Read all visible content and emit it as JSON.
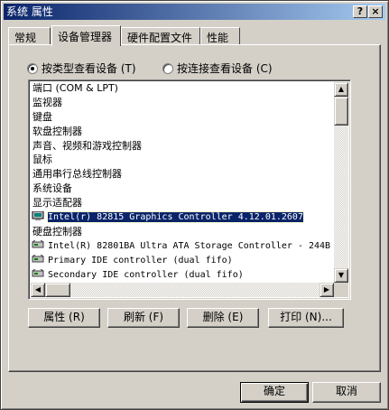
{
  "window": {
    "title": "系统 属性",
    "help_button": "?",
    "close_button": "×"
  },
  "tabs": [
    {
      "label": "常规"
    },
    {
      "label": "设备管理器"
    },
    {
      "label": "硬件配置文件"
    },
    {
      "label": "性能"
    }
  ],
  "view_options": {
    "by_type": "按类型查看设备 (T)",
    "by_connection": "按连接查看设备 (C)",
    "selected": "by_type"
  },
  "device_list": [
    {
      "text": "端口 (COM & LPT)",
      "icon": "",
      "child": false
    },
    {
      "text": "监视器",
      "icon": "",
      "child": false
    },
    {
      "text": "键盘",
      "icon": "",
      "child": false
    },
    {
      "text": "软盘控制器",
      "icon": "",
      "child": false
    },
    {
      "text": "声音、视频和游戏控制器",
      "icon": "",
      "child": false
    },
    {
      "text": "鼠标",
      "icon": "",
      "child": false
    },
    {
      "text": "通用串行总线控制器",
      "icon": "",
      "child": false
    },
    {
      "text": "系统设备",
      "icon": "",
      "child": false
    },
    {
      "text": "显示适配器",
      "icon": "",
      "child": false
    },
    {
      "text": "Intel(r) 82815 Graphics Controller 4.12.01.2607",
      "icon": "monitor-icon",
      "child": true,
      "selected": true
    },
    {
      "text": "硬盘控制器",
      "icon": "",
      "child": false
    },
    {
      "text": "Intel(R) 82801BA Ultra ATA Storage Controller - 244B",
      "icon": "disk-controller-icon",
      "child": true
    },
    {
      "text": "Primary IDE controller (dual fifo)",
      "icon": "disk-controller-icon",
      "child": true
    },
    {
      "text": "Secondary IDE controller (dual fifo)",
      "icon": "disk-controller-icon",
      "child": true
    }
  ],
  "buttons": {
    "properties": "属性 (R)",
    "refresh": "刷新 (F)",
    "remove": "删除 (E)",
    "print": "打印 (N)...",
    "ok": "确定",
    "cancel": "取消"
  },
  "colors": {
    "selection": "#0a246a",
    "face": "#d4d0c8",
    "title_start": "#0a246a",
    "title_end": "#a6caf0"
  }
}
